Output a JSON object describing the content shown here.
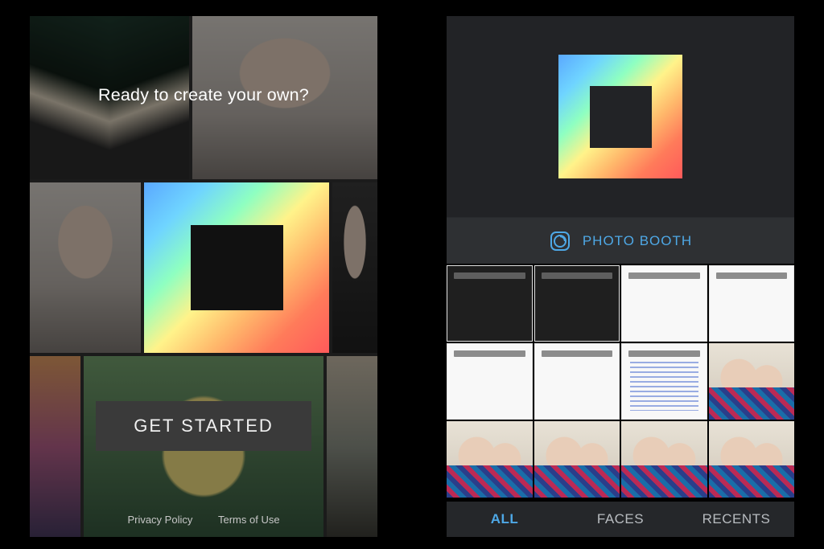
{
  "onboarding": {
    "headline": "Ready to create your own?",
    "cta_label": "GET STARTED",
    "legal": {
      "privacy": "Privacy Policy",
      "terms": "Terms of Use"
    }
  },
  "picker": {
    "photo_booth_label": "PHOTO BOOTH",
    "tabs": {
      "all": "ALL",
      "faces": "FACES",
      "recents": "RECENTS"
    },
    "active_tab": "ALL"
  },
  "colors": {
    "accent": "#4ea8e6",
    "button_bg": "#3a3a3a",
    "panel_bg": "#222326"
  }
}
